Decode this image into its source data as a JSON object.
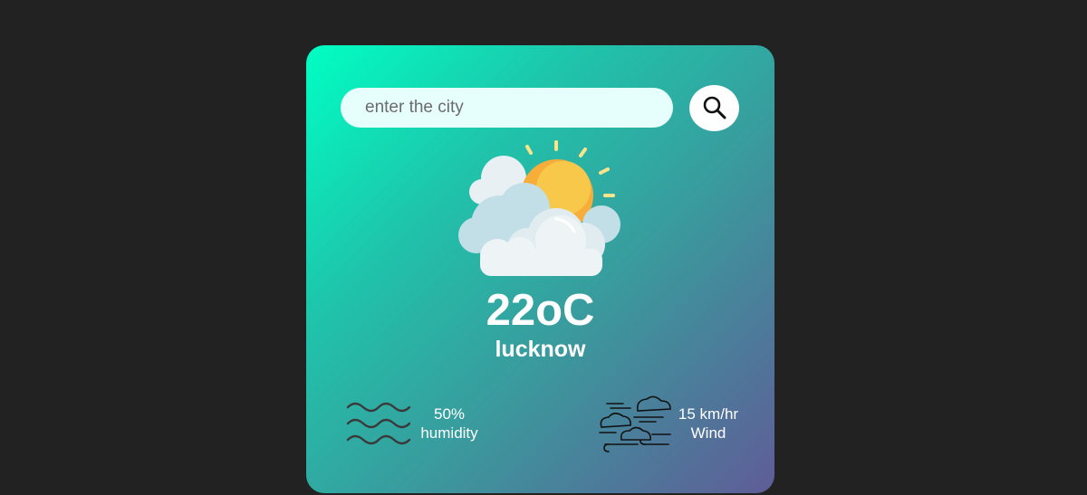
{
  "search": {
    "placeholder": "enter the city",
    "value": "",
    "button_icon": "search-icon"
  },
  "weather": {
    "icon": "sun-behind-clouds-icon",
    "temperature": "22oC",
    "city": "lucknow"
  },
  "details": {
    "humidity": {
      "icon": "waves-icon",
      "value": "50%",
      "label": "humidity"
    },
    "wind": {
      "icon": "wind-clouds-icon",
      "value": "15 km/hr",
      "label": "Wind"
    }
  },
  "colors": {
    "page_background": "#222222",
    "card_gradient_start": "#00ffc3",
    "card_gradient_end": "#5f5c97",
    "input_background": "#e6fffc",
    "text": "#ffffff"
  }
}
